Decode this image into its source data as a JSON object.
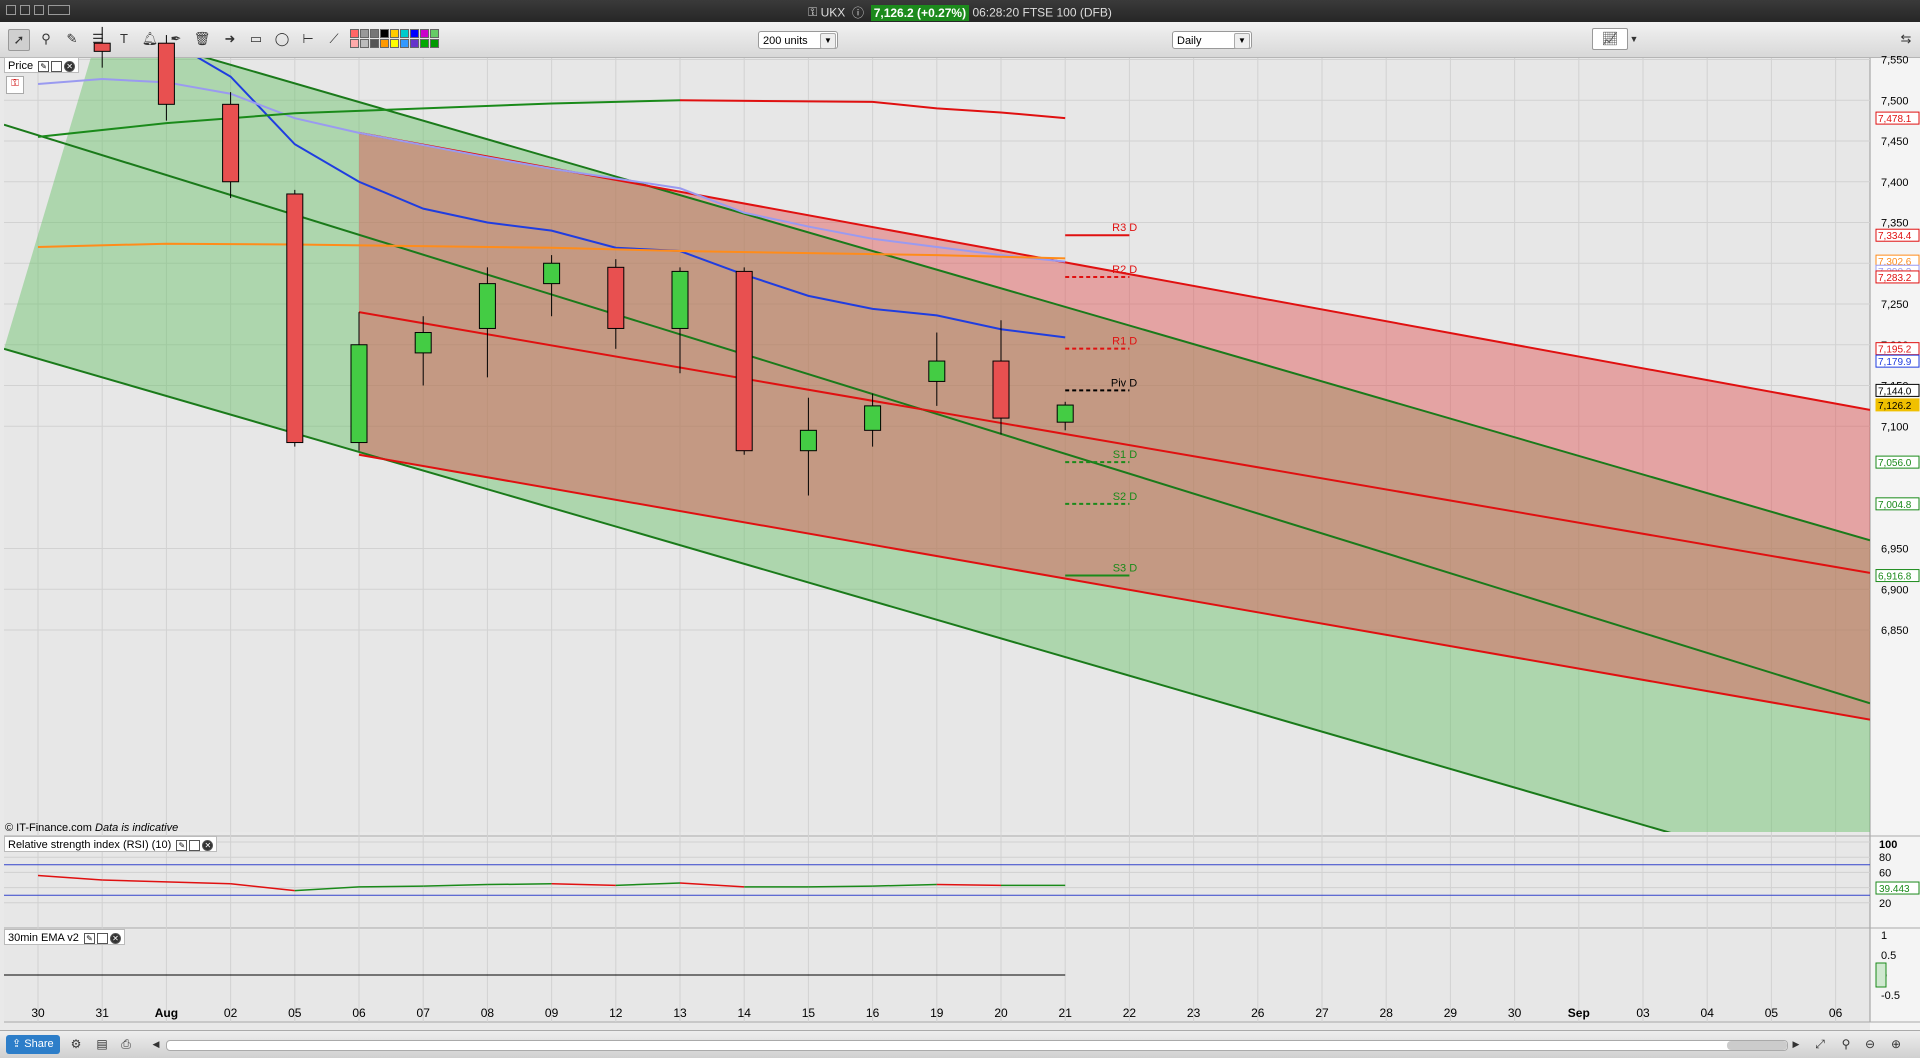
{
  "window": {
    "title_symbol": "UKX",
    "price_badge": "7,126.2 (+0.27%)",
    "time_label": "06:28:20 FTSE 100 (DFB)"
  },
  "toolbar": {
    "units_select": "200 units",
    "interval_select": "Daily",
    "swatch_colors": [
      "#ff6666",
      "#ffaaaa",
      "#999999",
      "#bbbbbb",
      "#777777",
      "#555555",
      "#000000",
      "#ff9900",
      "#ffcc00",
      "#ffff00",
      "#00cccc",
      "#3399ff",
      "#0000ff",
      "#6633cc",
      "#cc00cc",
      "#00aa00",
      "#66cc66",
      "#009900"
    ]
  },
  "price_panel": {
    "label": "Price",
    "copyright": "© IT-Finance.com",
    "disclaimer": "Data is indicative"
  },
  "rsi_panel": {
    "label": "Relative strength index (RSI) (10)",
    "axis_ticks": [
      "100",
      "80",
      "60",
      "40",
      "20"
    ],
    "value_badge": "39.443"
  },
  "ema_panel": {
    "label": "30min EMA v2",
    "axis_ticks": [
      "1",
      "0.5",
      "0",
      "-0.5"
    ]
  },
  "statusbar": {
    "share_label": "Share"
  },
  "chart_data": {
    "type": "candlestick",
    "symbol": "UKX",
    "instrument": "FTSE 100 (DFB)",
    "interval": "Daily",
    "ylim": [
      6800,
      7570
    ],
    "y_ticks": [
      6850,
      6900,
      6950,
      7100,
      7150,
      7200,
      7250,
      7300,
      7350,
      7400,
      7450,
      7500,
      7550
    ],
    "y_tick_labels": [
      "6,850",
      "6,900",
      "6,950",
      "7,100",
      "7,150",
      "7,200",
      "7,250",
      "7,300",
      "7,350",
      "7,400",
      "7,450",
      "7,500",
      "7,550"
    ],
    "x_labels": [
      "30",
      "31",
      "Aug",
      "02",
      "05",
      "06",
      "07",
      "08",
      "09",
      "12",
      "13",
      "14",
      "15",
      "16",
      "19",
      "20",
      "21",
      "22",
      "23",
      "26",
      "27",
      "28",
      "29",
      "30",
      "Sep",
      "03",
      "04",
      "05",
      "06"
    ],
    "candles": [
      {
        "date": "31",
        "open": 7570,
        "high": 7590,
        "low": 7540,
        "close": 7560,
        "up": false
      },
      {
        "date": "Aug",
        "open": 7570,
        "high": 7580,
        "low": 7475,
        "close": 7495,
        "up": false
      },
      {
        "date": "02",
        "open": 7495,
        "high": 7510,
        "low": 7380,
        "close": 7400,
        "up": false
      },
      {
        "date": "05",
        "open": 7385,
        "high": 7390,
        "low": 7075,
        "close": 7080,
        "up": false
      },
      {
        "date": "06",
        "open": 7080,
        "high": 7240,
        "low": 7070,
        "close": 7200,
        "up": true
      },
      {
        "date": "07",
        "open": 7190,
        "high": 7235,
        "low": 7150,
        "close": 7215,
        "up": true
      },
      {
        "date": "08",
        "open": 7220,
        "high": 7295,
        "low": 7160,
        "close": 7275,
        "up": true
      },
      {
        "date": "09",
        "open": 7275,
        "high": 7310,
        "low": 7235,
        "close": 7300,
        "up": true
      },
      {
        "date": "12",
        "open": 7295,
        "high": 7305,
        "low": 7195,
        "close": 7220,
        "up": false
      },
      {
        "date": "13",
        "open": 7220,
        "high": 7295,
        "low": 7165,
        "close": 7290,
        "up": true
      },
      {
        "date": "14",
        "open": 7290,
        "high": 7295,
        "low": 7065,
        "close": 7070,
        "up": false
      },
      {
        "date": "15",
        "open": 7070,
        "high": 7135,
        "low": 7015,
        "close": 7095,
        "up": true
      },
      {
        "date": "16",
        "open": 7095,
        "high": 7140,
        "low": 7075,
        "close": 7125,
        "up": true
      },
      {
        "date": "19",
        "open": 7155,
        "high": 7215,
        "low": 7125,
        "close": 7180,
        "up": true
      },
      {
        "date": "20",
        "open": 7180,
        "high": 7230,
        "low": 7090,
        "close": 7110,
        "up": false
      },
      {
        "date": "21",
        "open": 7105,
        "high": 7130,
        "low": 7095,
        "close": 7126,
        "up": true
      }
    ],
    "moving_averages": [
      {
        "color": "#1f3de0",
        "points": [
          [
            "Aug",
            7575
          ],
          [
            "02",
            7529
          ],
          [
            "05",
            7446
          ],
          [
            "06",
            7400
          ],
          [
            "07",
            7367
          ],
          [
            "08",
            7350
          ],
          [
            "09",
            7340
          ],
          [
            "12",
            7319
          ],
          [
            "13",
            7315
          ],
          [
            "14",
            7286
          ],
          [
            "15",
            7260
          ],
          [
            "16",
            7244
          ],
          [
            "19",
            7236
          ],
          [
            "20",
            7219
          ],
          [
            "21",
            7209
          ]
        ]
      },
      {
        "color": "#9a9af0",
        "points": [
          [
            "30",
            7520
          ],
          [
            "31",
            7526
          ],
          [
            "Aug",
            7522
          ],
          [
            "02",
            7508
          ],
          [
            "05",
            7478
          ],
          [
            "06",
            7460
          ],
          [
            "07",
            7445
          ],
          [
            "08",
            7430
          ],
          [
            "09",
            7416
          ],
          [
            "12",
            7404
          ],
          [
            "13",
            7392
          ],
          [
            "14",
            7362
          ],
          [
            "15",
            7345
          ],
          [
            "16",
            7330
          ],
          [
            "19",
            7320
          ],
          [
            "20",
            7310
          ],
          [
            "21",
            7302
          ]
        ]
      },
      {
        "color": "#ff8c1a",
        "points": [
          [
            "30",
            7320
          ],
          [
            "Aug",
            7324
          ],
          [
            "05",
            7323
          ],
          [
            "09",
            7319
          ],
          [
            "13",
            7315
          ],
          [
            "19",
            7310
          ],
          [
            "21",
            7306
          ]
        ]
      },
      {
        "color": "#1a8a1a",
        "points": [
          [
            "30",
            7455
          ],
          [
            "Aug",
            7472
          ],
          [
            "05",
            7484
          ],
          [
            "09",
            7496
          ],
          [
            "13",
            7500
          ]
        ]
      },
      {
        "color": "#e01010",
        "points": [
          [
            "13",
            7500
          ],
          [
            "16",
            7498
          ],
          [
            "19",
            7490
          ],
          [
            "20",
            7485
          ],
          [
            "21",
            7478
          ]
        ]
      }
    ],
    "pivot_levels": [
      {
        "label": "R3 D",
        "value": 7334.4,
        "style": "solid",
        "color": "#e01010"
      },
      {
        "label": "R2 D",
        "value": 7283.2,
        "style": "dashed",
        "color": "#e01010"
      },
      {
        "label": "R1 D",
        "value": 7195.2,
        "style": "dashed",
        "color": "#e01010"
      },
      {
        "label": "Piv D",
        "value": 7144.0,
        "style": "dashed",
        "color": "#000000"
      },
      {
        "label": "S1 D",
        "value": 7056.0,
        "style": "dashed",
        "color": "#1a8a1a"
      },
      {
        "label": "S2 D",
        "value": 7004.8,
        "style": "dashed",
        "color": "#1a8a1a"
      },
      {
        "label": "S3 D",
        "value": 6916.8,
        "style": "solid",
        "color": "#1a8a1a"
      }
    ],
    "price_badges": [
      {
        "text": "7,478.1",
        "value": 7478.1,
        "color": "#e01010"
      },
      {
        "text": "7,334.4",
        "value": 7334.4,
        "color": "#e01010"
      },
      {
        "text": "7,302.6",
        "value": 7302.6,
        "color": "#ff8c1a"
      },
      {
        "text": "7,290.2",
        "value": 7290.2,
        "color": "#9a9af0"
      },
      {
        "text": "7,283.2",
        "value": 7283.2,
        "color": "#e01010"
      },
      {
        "text": "7,195.2",
        "value": 7195.2,
        "color": "#e01010"
      },
      {
        "text": "7,179.9",
        "value": 7179.9,
        "color": "#1f3de0"
      },
      {
        "text": "7,144.0",
        "value": 7144.0,
        "color": "#000000"
      },
      {
        "text": "7,126.2",
        "value": 7126.2,
        "color": "#f0c000"
      },
      {
        "text": "7,056.0",
        "value": 7056.0,
        "color": "#1a8a1a"
      },
      {
        "text": "7,004.8",
        "value": 7004.8,
        "color": "#1a8a1a"
      },
      {
        "text": "6,916.8",
        "value": 6916.8,
        "color": "#1a8a1a"
      }
    ],
    "rsi": {
      "ylim": [
        0,
        100
      ],
      "levels": [
        70,
        30
      ],
      "value": 39.443,
      "points": [
        [
          "30",
          56
        ],
        [
          "31",
          50
        ],
        [
          "02",
          45
        ],
        [
          "05",
          36
        ],
        [
          "06",
          41
        ],
        [
          "07",
          42
        ],
        [
          "08",
          44
        ],
        [
          "09",
          45
        ],
        [
          "12",
          43
        ],
        [
          "13",
          46
        ],
        [
          "14",
          41
        ],
        [
          "15",
          41
        ],
        [
          "16",
          42
        ],
        [
          "19",
          44
        ],
        [
          "20",
          43
        ],
        [
          "21",
          43
        ]
      ]
    },
    "ema": {
      "ylim": [
        -1,
        1
      ],
      "value": 0
    }
  }
}
